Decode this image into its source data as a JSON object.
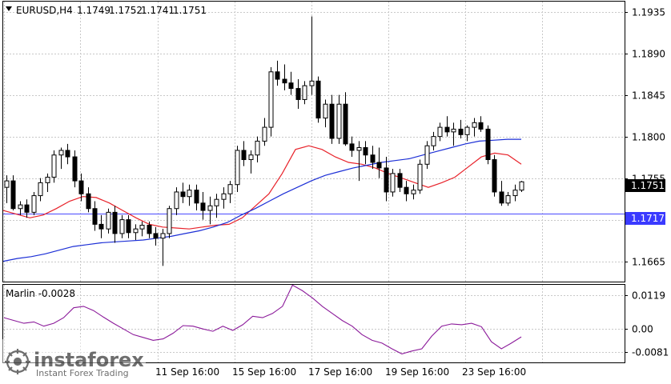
{
  "chart_data": [
    {
      "type": "candlestick",
      "symbol": "EURUSD,H4",
      "ohlc_header": [
        "1.1749",
        "1.1752",
        "1.1741",
        "1.1751"
      ],
      "price_axis": {
        "ylim": [
          1.1643,
          1.1946
        ],
        "ticks": [
          "1.1935",
          "1.1890",
          "1.1845",
          "1.1800",
          "1.1755",
          "1.1710",
          "1.1665"
        ]
      },
      "current_price_label": "1.1751",
      "current_price": 1.1751,
      "horizontal_line_label": "1.1717",
      "horizontal_line": 1.1717,
      "x_tick_labels": [
        "11 Sep 16:00",
        "15 Sep 16:00",
        "17 Sep 16:00",
        "19 Sep 16:00",
        "23 Sep 16:00"
      ],
      "grid": true,
      "candles": [
        [
          1.1745,
          1.1758,
          1.1728,
          1.1752
        ],
        [
          1.1752,
          1.1758,
          1.172,
          1.1722
        ],
        [
          1.1722,
          1.173,
          1.1715,
          1.1726
        ],
        [
          1.1726,
          1.1732,
          1.1712,
          1.1718
        ],
        [
          1.1718,
          1.174,
          1.1715,
          1.1736
        ],
        [
          1.1736,
          1.1755,
          1.173,
          1.175
        ],
        [
          1.175,
          1.176,
          1.174,
          1.1756
        ],
        [
          1.1756,
          1.1785,
          1.175,
          1.178
        ],
        [
          1.178,
          1.1788,
          1.1765,
          1.1785
        ],
        [
          1.1785,
          1.1792,
          1.177,
          1.1778
        ],
        [
          1.1778,
          1.1785,
          1.1745,
          1.1752
        ],
        [
          1.1752,
          1.176,
          1.173,
          1.1738
        ],
        [
          1.1738,
          1.1745,
          1.1718,
          1.1722
        ],
        [
          1.1722,
          1.173,
          1.1698,
          1.1705
        ],
        [
          1.1705,
          1.1715,
          1.169,
          1.17
        ],
        [
          1.17,
          1.1722,
          1.1695,
          1.1718
        ],
        [
          1.1718,
          1.1725,
          1.1685,
          1.1695
        ],
        [
          1.1695,
          1.1715,
          1.169,
          1.171
        ],
        [
          1.171,
          1.1715,
          1.169,
          1.1696
        ],
        [
          1.1696,
          1.1705,
          1.1688,
          1.17
        ],
        [
          1.17,
          1.1708,
          1.1692,
          1.1704
        ],
        [
          1.1704,
          1.1708,
          1.169,
          1.1695
        ],
        [
          1.1695,
          1.1702,
          1.1682,
          1.169
        ],
        [
          1.169,
          1.17,
          1.166,
          1.1695
        ],
        [
          1.1695,
          1.1725,
          1.169,
          1.1722
        ],
        [
          1.1722,
          1.1745,
          1.1715,
          1.174
        ],
        [
          1.174,
          1.175,
          1.1728,
          1.1735
        ],
        [
          1.1735,
          1.1748,
          1.1725,
          1.1742
        ],
        [
          1.1742,
          1.1748,
          1.172,
          1.1728
        ],
        [
          1.1728,
          1.174,
          1.171,
          1.172
        ],
        [
          1.172,
          1.1735,
          1.1705,
          1.1725
        ],
        [
          1.1725,
          1.1738,
          1.1712,
          1.1732
        ],
        [
          1.1732,
          1.1745,
          1.1722,
          1.1738
        ],
        [
          1.1738,
          1.1752,
          1.1728,
          1.1748
        ],
        [
          1.1748,
          1.179,
          1.174,
          1.1785
        ],
        [
          1.1785,
          1.1795,
          1.1768,
          1.1775
        ],
        [
          1.1775,
          1.1785,
          1.176,
          1.178
        ],
        [
          1.178,
          1.18,
          1.1772,
          1.1795
        ],
        [
          1.1795,
          1.182,
          1.179,
          1.181
        ],
        [
          1.181,
          1.1875,
          1.18,
          1.187
        ],
        [
          1.187,
          1.1882,
          1.1855,
          1.1862
        ],
        [
          1.1862,
          1.1878,
          1.185,
          1.1858
        ],
        [
          1.1858,
          1.187,
          1.1845,
          1.1852
        ],
        [
          1.1852,
          1.1862,
          1.183,
          1.184
        ],
        [
          1.184,
          1.186,
          1.1835,
          1.1855
        ],
        [
          1.1855,
          1.193,
          1.1845,
          1.186
        ],
        [
          1.186,
          1.1865,
          1.1815,
          1.182
        ],
        [
          1.182,
          1.184,
          1.181,
          1.1835
        ],
        [
          1.1835,
          1.1845,
          1.1792,
          1.1798
        ],
        [
          1.1798,
          1.1845,
          1.1792,
          1.1835
        ],
        [
          1.1835,
          1.1848,
          1.179,
          1.1792
        ],
        [
          1.1792,
          1.18,
          1.1778,
          1.1785
        ],
        [
          1.1785,
          1.1795,
          1.1752,
          1.1788
        ],
        [
          1.1788,
          1.1795,
          1.177,
          1.178
        ],
        [
          1.178,
          1.179,
          1.1765,
          1.1772
        ],
        [
          1.1772,
          1.1788,
          1.1755,
          1.1766
        ],
        [
          1.1766,
          1.1778,
          1.173,
          1.174
        ],
        [
          1.174,
          1.1765,
          1.1735,
          1.176
        ],
        [
          1.176,
          1.1765,
          1.174,
          1.1745
        ],
        [
          1.1745,
          1.1752,
          1.173,
          1.1738
        ],
        [
          1.1738,
          1.1748,
          1.1732,
          1.1742
        ],
        [
          1.1742,
          1.1775,
          1.1738,
          1.177
        ],
        [
          1.177,
          1.1795,
          1.1765,
          1.179
        ],
        [
          1.179,
          1.1805,
          1.1785,
          1.18
        ],
        [
          1.18,
          1.1815,
          1.1795,
          1.181
        ],
        [
          1.181,
          1.1822,
          1.18,
          1.1805
        ],
        [
          1.1805,
          1.1815,
          1.179,
          1.1808
        ],
        [
          1.1808,
          1.1818,
          1.1798,
          1.1802
        ],
        [
          1.1802,
          1.1812,
          1.1795,
          1.181
        ],
        [
          1.181,
          1.182,
          1.18,
          1.1815
        ],
        [
          1.1815,
          1.1822,
          1.1805,
          1.1808
        ],
        [
          1.1808,
          1.1812,
          1.177,
          1.1775
        ],
        [
          1.1775,
          1.178,
          1.1735,
          1.174
        ],
        [
          1.174,
          1.1752,
          1.1725,
          1.1728
        ],
        [
          1.1728,
          1.174,
          1.1725,
          1.1736
        ],
        [
          1.1736,
          1.1748,
          1.173,
          1.1742
        ],
        [
          1.1742,
          1.1752,
          1.174,
          1.1751
        ]
      ],
      "series": [
        {
          "values": [
            1.172,
            1.1716,
            1.1712,
            1.1715,
            1.1722,
            1.173,
            1.1735,
            1.1734,
            1.1728,
            1.172,
            1.1712,
            1.1705,
            1.1702,
            1.1701,
            1.17,
            1.1702,
            1.1704,
            1.1705,
            1.1712,
            1.1725,
            1.1738,
            1.176,
            1.1786,
            1.179,
            1.1786,
            1.1778,
            1.1772,
            1.177,
            1.1766,
            1.176,
            1.1755,
            1.175,
            1.1745,
            1.175,
            1.1756,
            1.1767,
            1.1778,
            1.1782,
            1.178,
            1.177
          ]
        },
        {
          "values": [
            1.1665,
            1.1668,
            1.167,
            1.1673,
            1.1677,
            1.1681,
            1.1683,
            1.1685,
            1.1686,
            1.1687,
            1.1688,
            1.169,
            1.1692,
            1.1695,
            1.1698,
            1.1702,
            1.1707,
            1.1715,
            1.1722,
            1.173,
            1.1738,
            1.1745,
            1.1752,
            1.1758,
            1.1762,
            1.1766,
            1.1769,
            1.1772,
            1.1774,
            1.1776,
            1.178,
            1.1784,
            1.1788,
            1.1792,
            1.1795,
            1.1796,
            1.1797,
            1.1797
          ]
        }
      ]
    },
    {
      "type": "line",
      "indicator_label": "Marlin -0.0028",
      "ylim": [
        -0.0118,
        0.0156
      ],
      "ticks": [
        "0.0119",
        "0.00",
        "-0.0081"
      ],
      "series": [
        {
          "values": [
            0.004,
            0.003,
            0.002,
            0.0025,
            0.001,
            0.002,
            0.004,
            0.0075,
            0.008,
            0.0065,
            0.0042,
            0.002,
            0.0,
            -0.002,
            -0.003,
            -0.004,
            -0.0035,
            -0.0015,
            0.0012,
            0.001,
            0.0,
            -0.0008,
            0.001,
            -0.0005,
            0.0015,
            0.0045,
            0.004,
            0.0055,
            0.008,
            0.0155,
            0.0135,
            0.011,
            0.008,
            0.0055,
            0.003,
            0.001,
            -0.002,
            -0.004,
            -0.005,
            -0.007,
            -0.0088,
            -0.0078,
            -0.007,
            -0.0025,
            0.001,
            0.0018,
            0.0015,
            0.002,
            0.0008,
            -0.0045,
            -0.007,
            -0.005,
            -0.0028
          ]
        }
      ]
    }
  ],
  "watermark": {
    "brand": "instaforex",
    "tagline": "Instant Forex Trading"
  }
}
